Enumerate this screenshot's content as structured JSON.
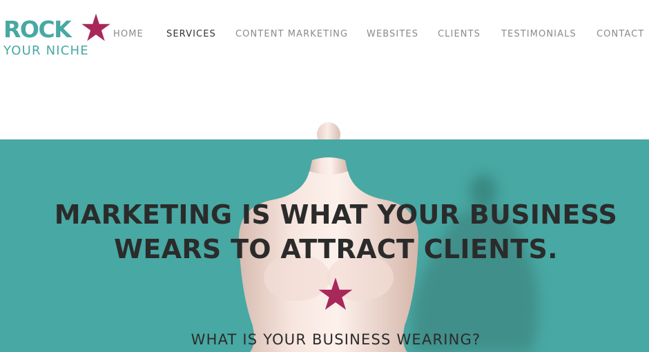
{
  "brand": {
    "logo_line1": "ROCK",
    "logo_line2": "YOUR NICHE",
    "primary_color": "#48a8a4",
    "star_color": "#a8285a"
  },
  "nav": {
    "items": [
      {
        "label": "HOME",
        "active": false
      },
      {
        "label": "SERVICES",
        "active": true
      },
      {
        "label": "CONTENT MARKETING",
        "active": false
      },
      {
        "label": "WEBSITES",
        "active": false
      },
      {
        "label": "CLIENTS",
        "active": false
      },
      {
        "label": "TESTIMONIALS",
        "active": false
      },
      {
        "label": "CONTACT",
        "active": false
      }
    ]
  },
  "hero": {
    "headline_line1": "MARKETING IS WHAT YOUR BUSINESS",
    "headline_line2": "WEARS TO ATTRACT CLIENTS.",
    "subline": "WHAT IS YOUR BUSINESS WEARING?",
    "background_color": "#48a8a3",
    "text_color": "#2b2b2b",
    "star_icon": "star-icon",
    "image": "dress-form-mannequin"
  }
}
